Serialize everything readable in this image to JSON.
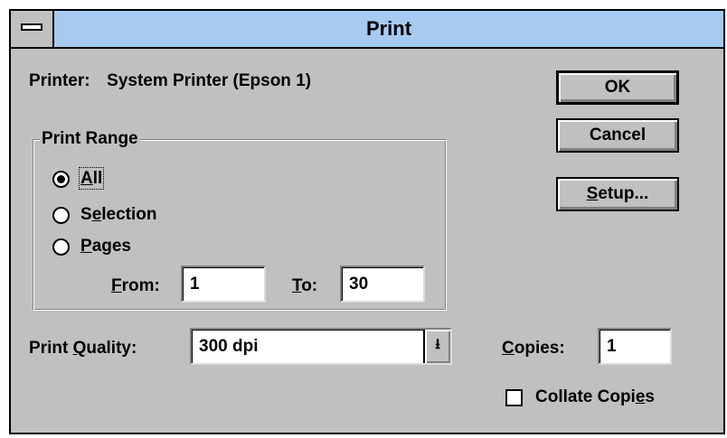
{
  "window": {
    "title": "Print"
  },
  "printer": {
    "label": "Printer:",
    "name": "System Printer (Epson 1)"
  },
  "buttons": {
    "ok": "OK",
    "cancel": "Cancel",
    "setup_u": "S",
    "setup_rest": "etup..."
  },
  "print_range": {
    "legend": "Print Range",
    "all": {
      "u": "A",
      "rest": "ll",
      "selected": true
    },
    "selection": {
      "a": "S",
      "u": "e",
      "rest": "lection",
      "selected": false
    },
    "pages": {
      "u": "P",
      "rest": "ages",
      "selected": false
    },
    "from": {
      "u": "F",
      "rest": "rom:",
      "value": "1"
    },
    "to": {
      "u": "T",
      "rest": "o:",
      "value": "30"
    }
  },
  "quality": {
    "pre": "Print ",
    "u": "Q",
    "rest": "uality:",
    "value": "300 dpi",
    "arrow": "down-arrow-icon"
  },
  "copies": {
    "u": "C",
    "rest": "opies:",
    "value": "1"
  },
  "collate": {
    "pre": "Collate Copi",
    "u": "e",
    "rest": "s",
    "checked": false
  }
}
